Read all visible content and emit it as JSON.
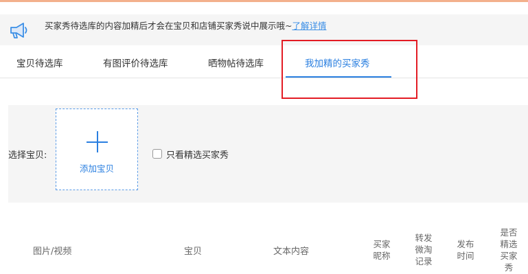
{
  "notice": {
    "icon": "megaphone-icon",
    "text": "买家秀待选库的内容加精后才会在宝贝和店铺买家秀说中展示哦~",
    "link": "了解详情"
  },
  "tabs": [
    {
      "label": "宝贝待选库",
      "active": false
    },
    {
      "label": "有图评价待选库",
      "active": false
    },
    {
      "label": "晒物帖待选库",
      "active": false
    },
    {
      "label": "我加精的买家秀",
      "active": true
    }
  ],
  "filter": {
    "label": "选择宝贝:",
    "add_button": "添加宝贝",
    "checkbox_label": "只看精选买家秀",
    "checkbox_checked": false
  },
  "table": {
    "headers": {
      "media": "图片/视频",
      "item": "宝贝",
      "content": "文本内容",
      "nickname": "买家昵称",
      "repost": "转发微淘记录",
      "publish_time": "发布时间",
      "featured": "是否精选买家秀"
    }
  },
  "colors": {
    "accent": "#2a7fe0",
    "highlight": "#e31b23",
    "panel": "#f5f5f5"
  }
}
